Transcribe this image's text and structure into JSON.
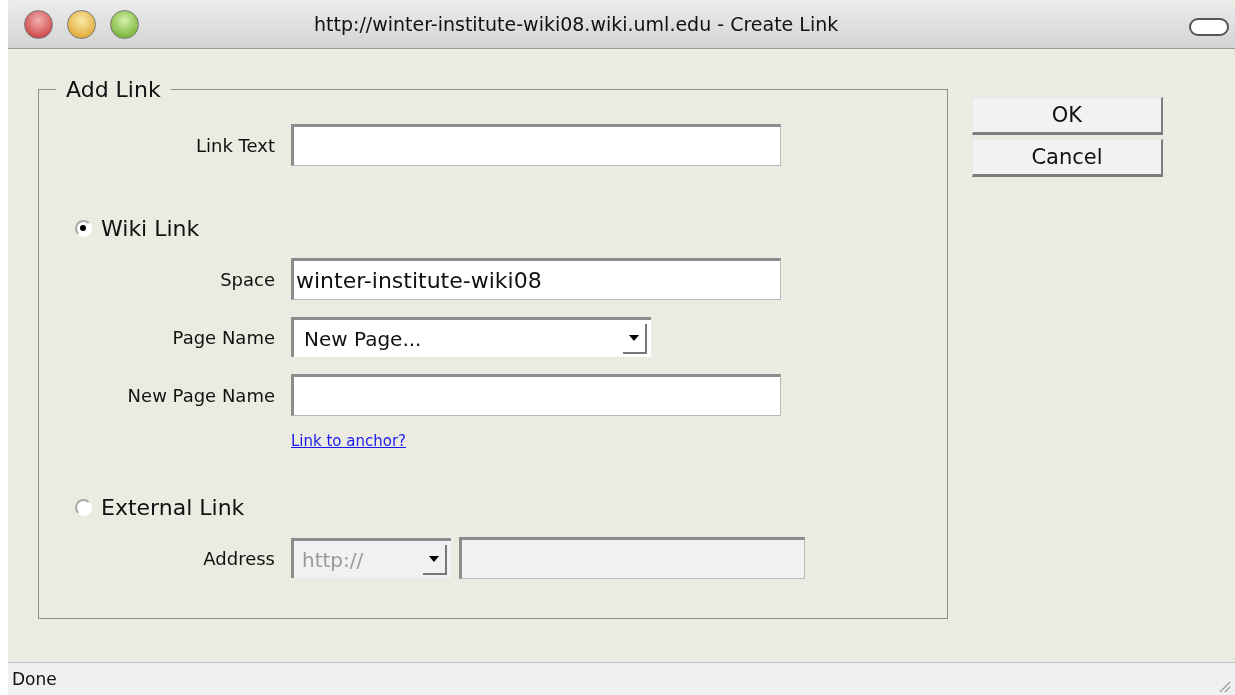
{
  "window": {
    "title": "http://winter-institute-wiki08.wiki.uml.edu - Create Link"
  },
  "dialog": {
    "legend": "Add Link",
    "link_text": {
      "label": "Link Text"
    },
    "link_types": [
      {
        "label": "Wiki Link",
        "selected": true,
        "fields": [
          {
            "kind": "text",
            "label": "Space",
            "value": "winter-institute-wiki08"
          },
          {
            "kind": "select",
            "label": "Page Name",
            "value": "New Page..."
          },
          {
            "kind": "text",
            "label": "New Page Name"
          },
          {
            "kind": "link",
            "label": "Link to anchor?"
          }
        ]
      },
      {
        "label": "External Link",
        "selected": false,
        "fields": [
          {
            "kind": "address",
            "label": "Address",
            "value": "http://",
            "disabled": true
          }
        ]
      }
    ]
  },
  "buttons": [
    "OK",
    "Cancel"
  ],
  "status_bar": "Done"
}
